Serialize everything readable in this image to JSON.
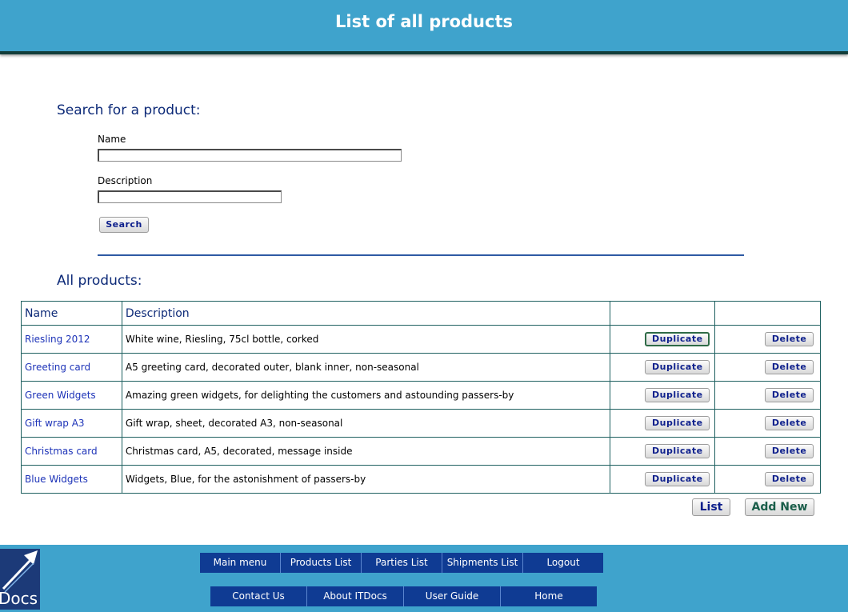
{
  "header": {
    "title": "List of all products"
  },
  "search": {
    "heading": "Search for a product:",
    "name_label": "Name",
    "name_value": "",
    "description_label": "Description",
    "description_value": "",
    "button_label": "Search"
  },
  "products": {
    "heading": "All products:",
    "columns": [
      "Name",
      "Description",
      "",
      ""
    ],
    "duplicate_label": "Duplicate",
    "delete_label": "Delete",
    "rows": [
      {
        "name": "Riesling 2012",
        "description": "White wine, Riesling, 75cl bottle, corked"
      },
      {
        "name": "Greeting card",
        "description": "A5 greeting card, decorated outer, blank inner, non-seasonal"
      },
      {
        "name": "Green Widgets",
        "description": "Amazing green widgets, for delighting the customers and astounding passers-by"
      },
      {
        "name": "Gift wrap A3",
        "description": "Gift wrap, sheet, decorated A3, non-seasonal"
      },
      {
        "name": "Christmas card",
        "description": "Christmas card, A5, decorated, message inside"
      },
      {
        "name": "Blue Widgets",
        "description": "Widgets, Blue, for the astonishment of passers-by"
      }
    ],
    "list_button": "List",
    "add_new_button": "Add New"
  },
  "footer": {
    "logo_text": "Docs",
    "nav_top": [
      "Main menu",
      "Products List",
      "Parties List",
      "Shipments List",
      "Logout"
    ],
    "nav_bottom": [
      "Contact Us",
      "About ITDocs",
      "User Guide",
      "Home"
    ]
  },
  "colors": {
    "header_bg": "#3fa3cc",
    "nav_bg": "#0f3b93",
    "heading_text": "#0d2a78",
    "link_text": "#1d33b8",
    "table_border": "#1e6060"
  }
}
